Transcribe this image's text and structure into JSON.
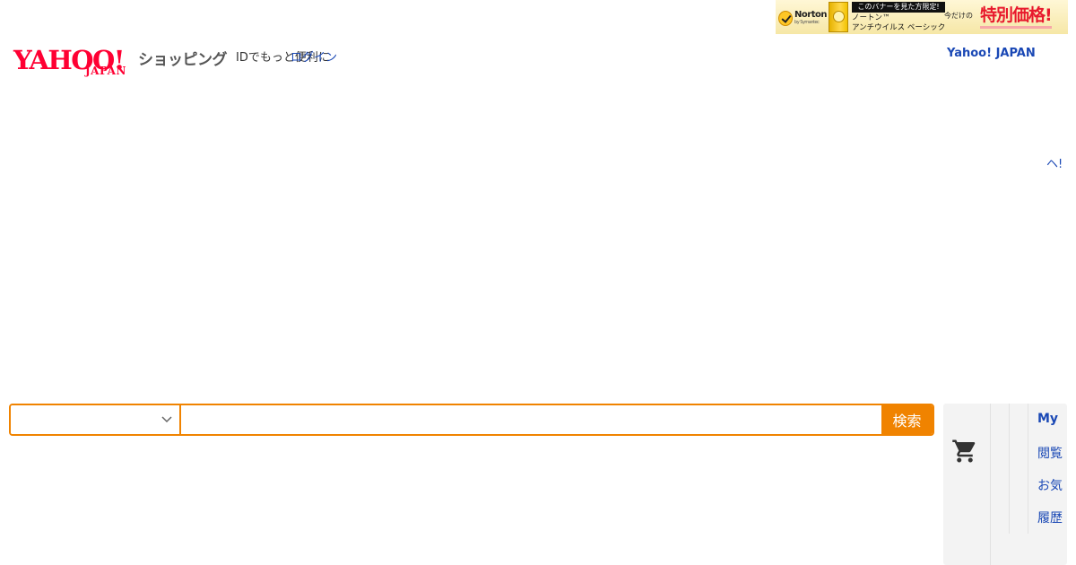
{
  "banner": {
    "brand": "Norton",
    "brand_sub": "by Symantec",
    "promo_tag": "このバナーを見た方限定!",
    "product_line1": "ノートン™",
    "product_line2": "アンチウイルス ベーシック",
    "limited_text": "今だけの",
    "price_text": "特別価格!"
  },
  "header": {
    "logo_text": "YAHOO!",
    "logo_sub": "JAPAN",
    "service_name": "ショッピング",
    "id_text": "IDでもっと便利に",
    "login_link": "ログイン",
    "yj_link": "Yahoo! JAPAN",
    "right_link": "ヘ!"
  },
  "search": {
    "category_value": "",
    "query_value": "",
    "button_label": "検索"
  },
  "side_panel": {
    "cart_icon": "shopping-cart-icon",
    "my_label": "My",
    "links": [
      "閲覧",
      "お気",
      "履歴"
    ]
  },
  "colors": {
    "accent": "#f08300",
    "link": "#1a48b5",
    "brand": "#ff0033"
  }
}
